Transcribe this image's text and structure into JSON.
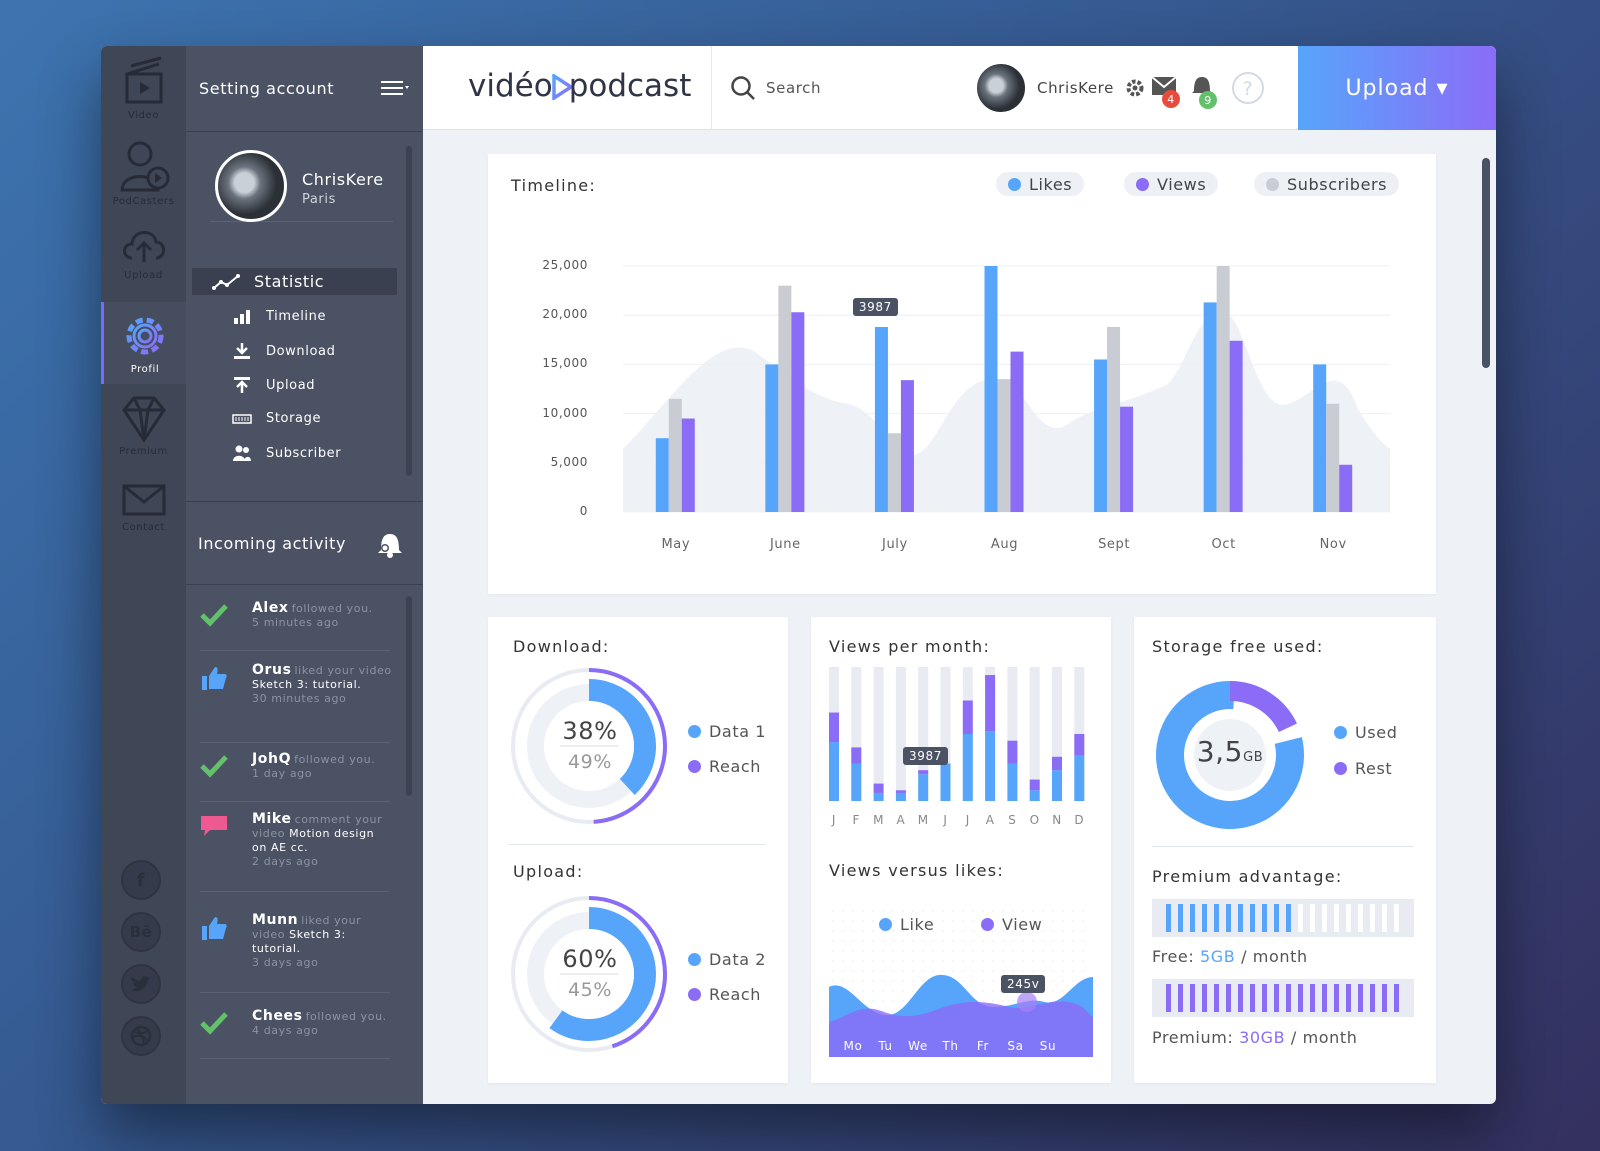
{
  "rail": [
    {
      "label": "Video",
      "icon": "clapperboard-icon"
    },
    {
      "label": "PodCasters",
      "icon": "podcaster-icon"
    },
    {
      "label": "Upload",
      "icon": "cloud-upload-icon"
    },
    {
      "label": "Profil",
      "icon": "gear-icon"
    },
    {
      "label": "Premium",
      "icon": "diamond-icon"
    },
    {
      "label": "Contact",
      "icon": "envelope-icon"
    }
  ],
  "social": [
    "f",
    "Bē",
    "twitter",
    "dribbble"
  ],
  "side": {
    "title": "Setting account",
    "user": "ChrisKere",
    "city": "Paris",
    "statistic": "Statistic",
    "items": [
      {
        "label": "Timeline",
        "icon": "bar-chart-icon"
      },
      {
        "label": "Download",
        "icon": "download-icon"
      },
      {
        "label": "Upload",
        "icon": "upload-icon"
      },
      {
        "label": "Storage",
        "icon": "storage-icon"
      },
      {
        "label": "Subscriber",
        "icon": "users-icon"
      }
    ],
    "activity_title": "Incoming activity",
    "activity": [
      {
        "name": "Alex",
        "action": "followed you.",
        "extra": "",
        "time": "5 minutes ago",
        "icon": "check-icon"
      },
      {
        "name": "Orus",
        "action": "liked your video",
        "extra": "Sketch 3: tutorial.",
        "time": "30 minutes ago",
        "icon": "thumbs-up-icon"
      },
      {
        "name": "JohQ",
        "action": "followed you.",
        "extra": "",
        "time": "1 day ago",
        "icon": "check-icon"
      },
      {
        "name": "Mike",
        "action": "comment your video",
        "extra": "Motion design on AE cc.",
        "time": "2 days ago",
        "icon": "comment-icon"
      },
      {
        "name": "Munn",
        "action": "liked your video",
        "extra": "Sketch 3: tutorial.",
        "time": "3 days ago",
        "icon": "thumbs-up-icon"
      },
      {
        "name": "Chees",
        "action": "followed you.",
        "extra": "",
        "time": "4 days ago",
        "icon": "check-icon"
      }
    ]
  },
  "top": {
    "logo_a": "vidéo",
    "logo_b": "podcast",
    "search": "Search",
    "user": "ChrisKere",
    "mail_count": "4",
    "notif_count": "9",
    "upload": "Upload ▾"
  },
  "colors": {
    "likes": "#57a5fb",
    "views": "#8b6cf7",
    "subs": "#c9cdd3"
  },
  "timeline": {
    "title": "Timeline:",
    "legend": [
      "Likes",
      "Views",
      "Subscribers"
    ],
    "tooltip": "3987"
  },
  "chart_data": [
    {
      "type": "bar",
      "title": "Timeline:",
      "categories": [
        "May",
        "June",
        "July",
        "Aug",
        "Sept",
        "Oct",
        "Nov"
      ],
      "series": [
        {
          "name": "Likes",
          "values": [
            7500,
            15000,
            18800,
            25000,
            15500,
            21300,
            15000
          ]
        },
        {
          "name": "Subscribers",
          "values": [
            11500,
            23000,
            8000,
            13500,
            18800,
            25000,
            11000
          ]
        },
        {
          "name": "Views",
          "values": [
            9500,
            20300,
            13400,
            16300,
            10700,
            17400,
            4800
          ]
        }
      ],
      "yticks": [
        "25,000",
        "20,000",
        "15,000",
        "10,000",
        "5,000",
        "0"
      ],
      "ylim": [
        0,
        25000
      ],
      "legend": "top-right"
    },
    {
      "type": "pie",
      "title": "Download:",
      "labels": [
        "Data 1",
        "Reach"
      ],
      "values": [
        38,
        49
      ],
      "display": [
        "38%",
        "49%"
      ]
    },
    {
      "type": "pie",
      "title": "Upload:",
      "labels": [
        "Data 2",
        "Reach"
      ],
      "values": [
        60,
        45
      ],
      "display": [
        "60%",
        "45%"
      ]
    },
    {
      "type": "bar",
      "title": "Views per month:",
      "categories": [
        "J",
        "F",
        "M",
        "A",
        "M",
        "J",
        "J",
        "A",
        "S",
        "O",
        "N",
        "D"
      ],
      "series": [
        {
          "name": "Likes",
          "values": [
            0.44,
            0.28,
            0.06,
            0.06,
            0.2,
            0.28,
            0.5,
            0.52,
            0.28,
            0.08,
            0.23,
            0.34
          ]
        },
        {
          "name": "Views",
          "values": [
            0.22,
            0.12,
            0.07,
            0.02,
            0.03,
            0.0,
            0.25,
            0.42,
            0.17,
            0.08,
            0.1,
            0.16
          ]
        }
      ],
      "tooltip": "3987"
    },
    {
      "type": "area",
      "title": "Views versus likes:",
      "categories": [
        "Mo",
        "Tu",
        "We",
        "Th",
        "Fr",
        "Sa",
        "Su"
      ],
      "legend": [
        "Like",
        "View"
      ],
      "tooltip": "245v"
    },
    {
      "type": "pie",
      "title": "Storage free used:",
      "labels": [
        "Used",
        "Rest"
      ],
      "values": [
        80,
        20
      ],
      "center": "3,5",
      "center_unit": "GB"
    }
  ],
  "premium": {
    "title": "Premium advantage:",
    "free_label": "Free:",
    "free_value": "5GB",
    "free_unit": "/ month",
    "free_fill": 0.55,
    "prem_label": "Premium:",
    "prem_value": "30GB",
    "prem_unit": "/ month",
    "prem_fill": 1.0
  }
}
